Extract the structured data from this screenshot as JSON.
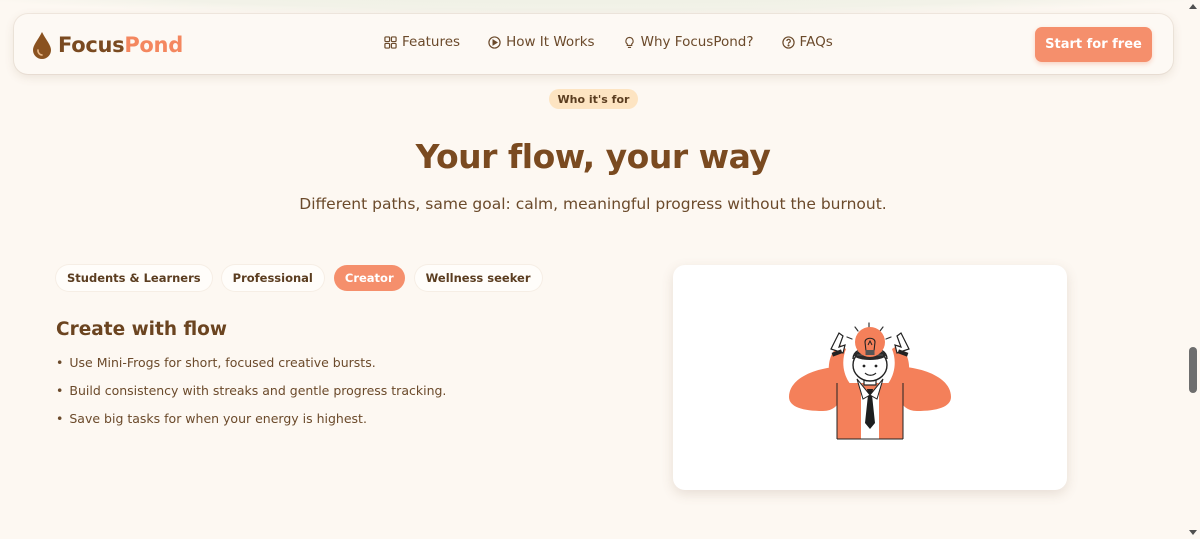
{
  "brand": {
    "part1": "Focus",
    "part2": "Pond"
  },
  "nav": {
    "links": [
      {
        "label": "Features",
        "icon": "grid-icon"
      },
      {
        "label": "How It Works",
        "icon": "play-circle-icon"
      },
      {
        "label": "Why FocusPond?",
        "icon": "lightbulb-icon"
      },
      {
        "label": "FAQs",
        "icon": "question-circle-icon"
      }
    ],
    "cta": "Start for free"
  },
  "section": {
    "badge": "Who it's for",
    "title": "Your flow, your way",
    "subtitle": "Different paths, same goal: calm, meaningful progress without the burnout."
  },
  "tabs": [
    {
      "label": "Students & Learners",
      "active": false
    },
    {
      "label": "Professional",
      "active": false
    },
    {
      "label": "Creator",
      "active": true
    },
    {
      "label": "Wellness seeker",
      "active": false
    }
  ],
  "panel": {
    "title": "Create with flow",
    "bullets": [
      "Use Mini-Frogs for short, focused creative bursts.",
      "Build consistency with streaks and gentle progress tracking.",
      "Save big tasks for when your energy is highest."
    ],
    "illustration": "creator-lightbulb-illustration"
  },
  "colors": {
    "accent": "#f58f6c",
    "brown": "#7a4a20",
    "badge_bg": "#fde4c2",
    "background": "#fdf8f2"
  }
}
